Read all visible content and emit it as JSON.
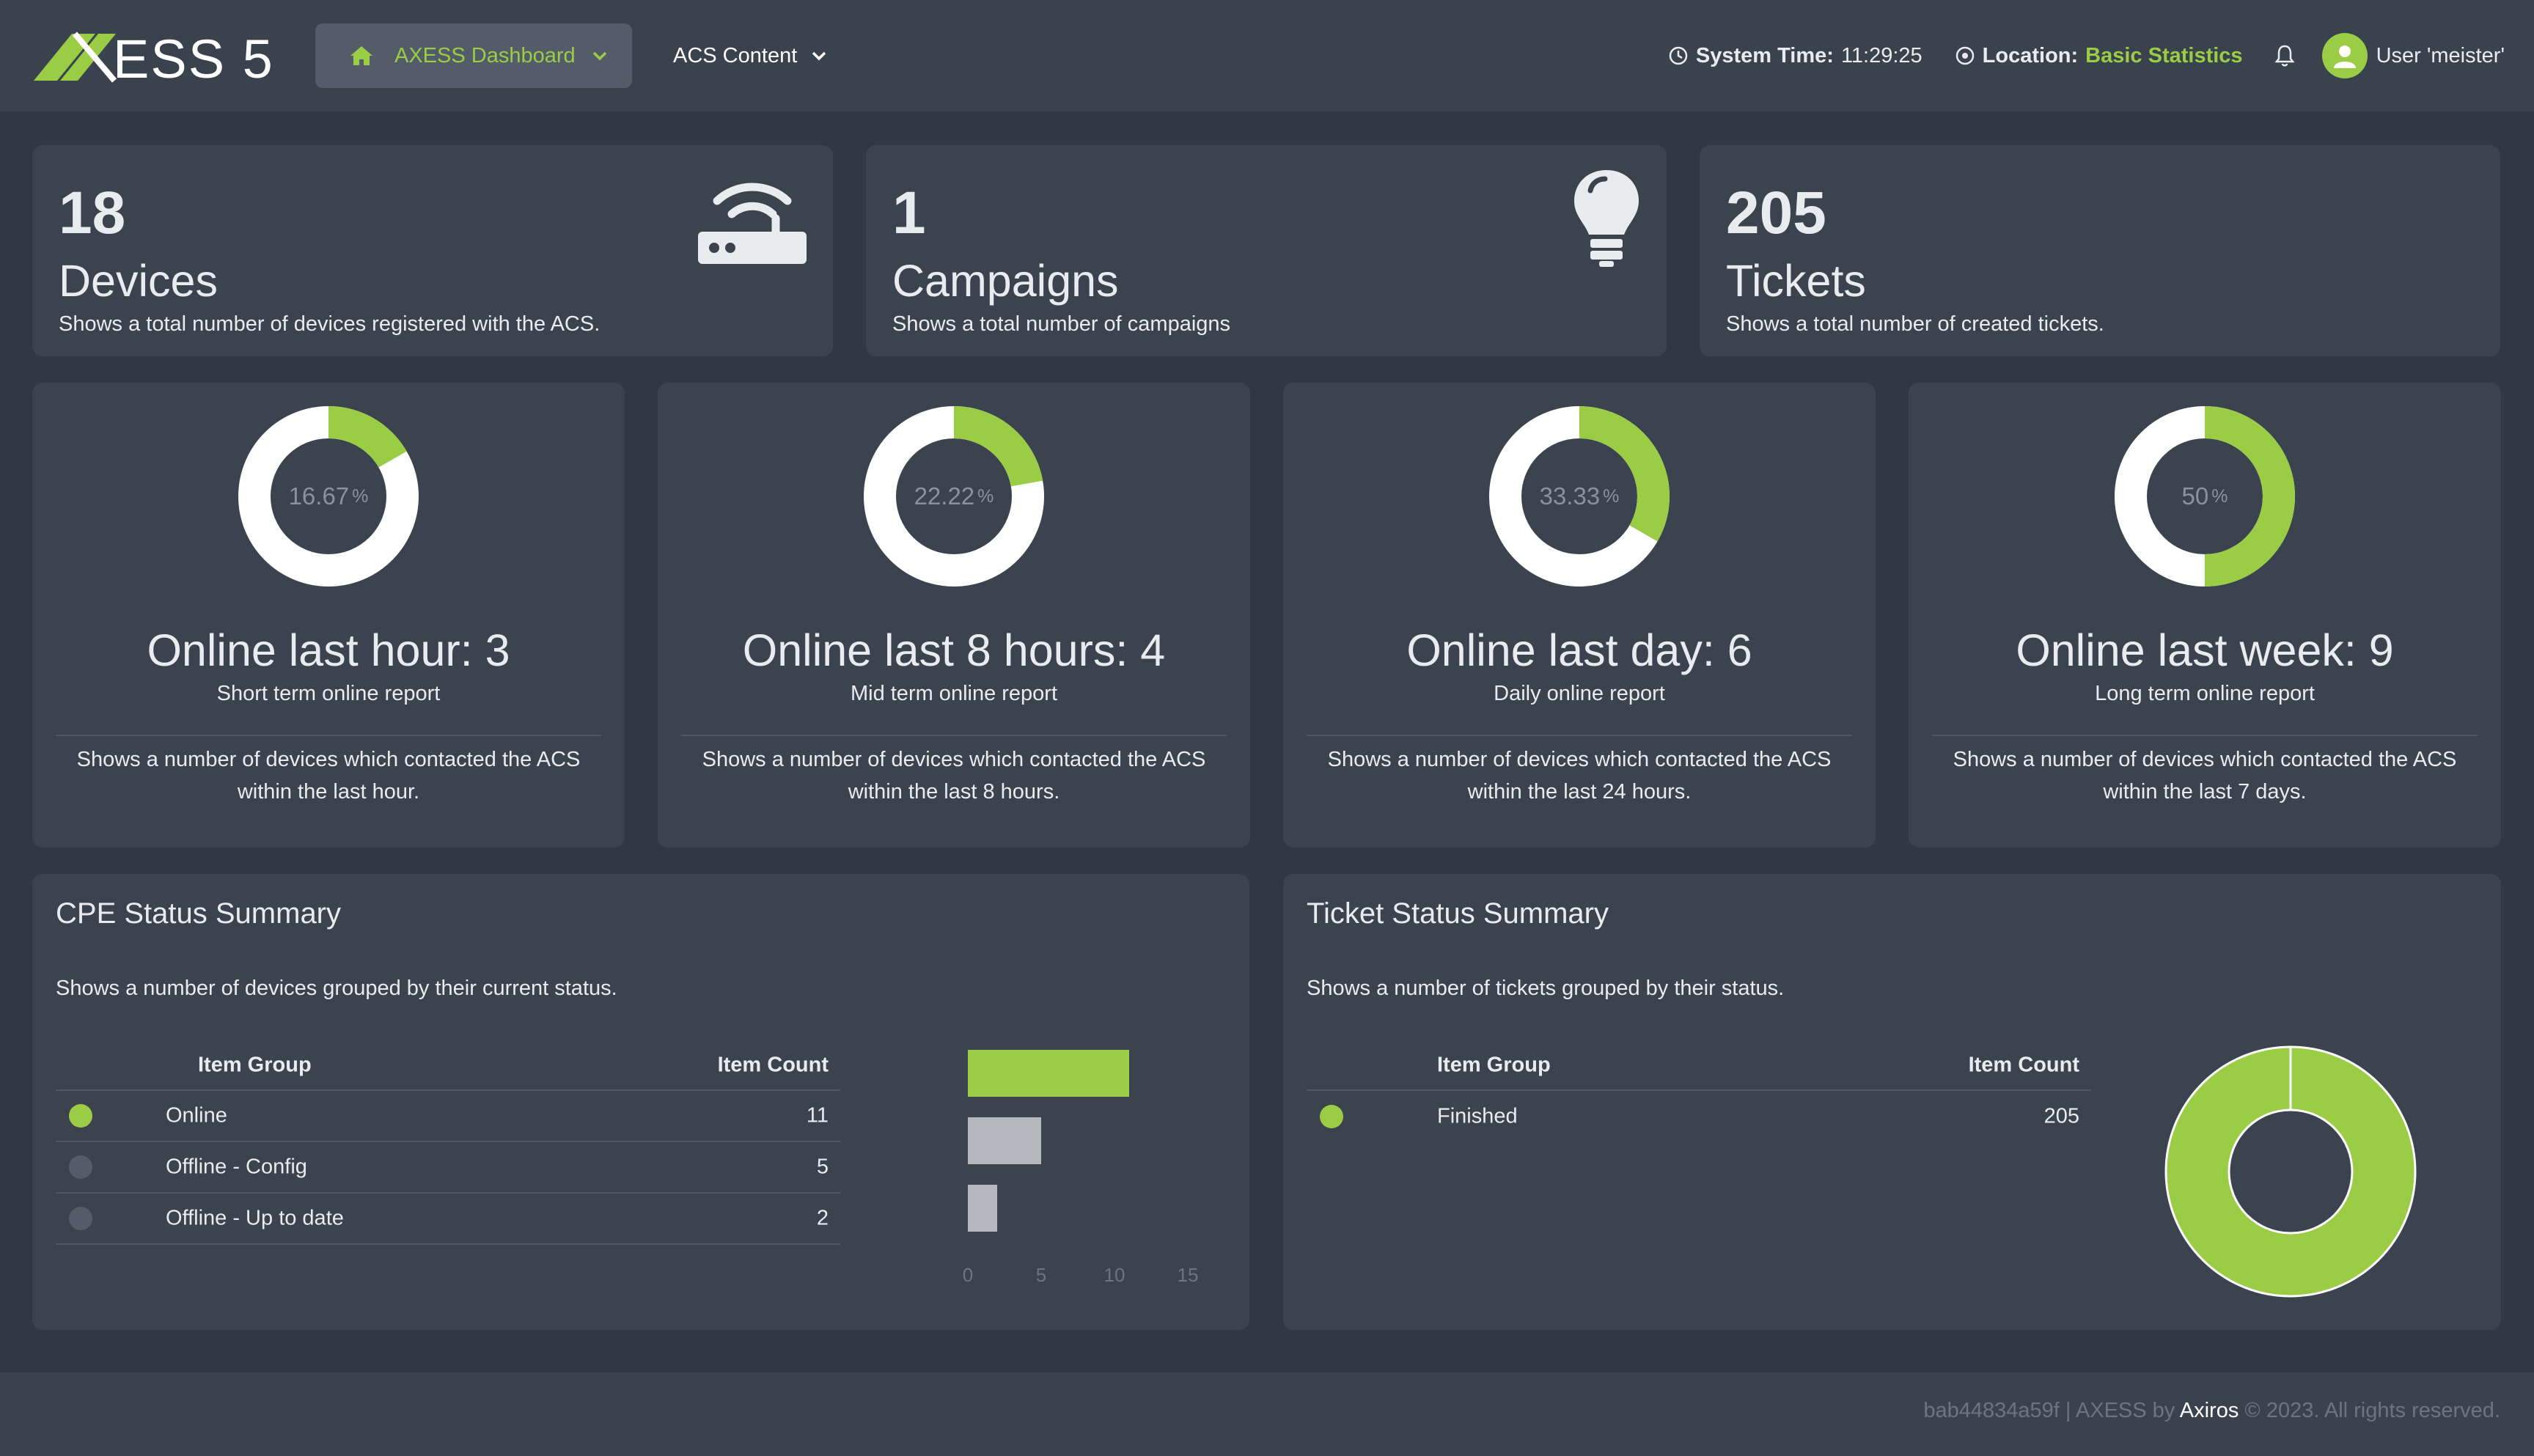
{
  "colors": {
    "accent": "#9acd45",
    "card": "#3a434e",
    "background": "#2f3843",
    "muted": "#535c68",
    "bar_gray": "#b4b8bd"
  },
  "header": {
    "logo_text": "AXESS 5",
    "nav_dashboard_label": "AXESS Dashboard",
    "nav_dashboard_icon": "home-icon",
    "nav_acs_label": "ACS Content",
    "system_time_label": "System Time:",
    "system_time_value": "11:29:25",
    "location_label": "Location:",
    "location_value": "Basic Statistics",
    "user_label": "User 'meister'"
  },
  "stats": [
    {
      "number": "18",
      "title": "Devices",
      "desc": "Shows a total number of devices registered with the ACS.",
      "icon": "router-icon"
    },
    {
      "number": "1",
      "title": "Campaigns",
      "desc": "Shows a total number of campaigns",
      "icon": "lightbulb-icon"
    },
    {
      "number": "205",
      "title": "Tickets",
      "desc": "Shows a total number of created tickets."
    }
  ],
  "online": [
    {
      "percent": "16.67",
      "percent_value": 16.67,
      "pct_sign": "%",
      "title": "Online last hour: 3",
      "subtitle": "Short term online report",
      "desc": "Shows a number of devices which contacted the ACS within the last hour."
    },
    {
      "percent": "22.22",
      "percent_value": 22.22,
      "pct_sign": "%",
      "title": "Online last 8 hours: 4",
      "subtitle": "Mid term online report",
      "desc": "Shows a number of devices which contacted the ACS within the last 8 hours."
    },
    {
      "percent": "33.33",
      "percent_value": 33.33,
      "pct_sign": "%",
      "title": "Online last day: 6",
      "subtitle": "Daily online report",
      "desc": "Shows a number of devices which contacted the ACS within the last 24 hours."
    },
    {
      "percent": "50",
      "percent_value": 50,
      "pct_sign": "%",
      "title": "Online last week: 9",
      "subtitle": "Long term online report",
      "desc": "Shows a number of devices which contacted the ACS within the last 7 days."
    }
  ],
  "cpe": {
    "title": "CPE Status Summary",
    "desc": "Shows a number of devices grouped by their current status.",
    "col_group": "Item Group",
    "col_count": "Item Count",
    "rows": [
      {
        "group": "Online",
        "count": "11",
        "status": "on"
      },
      {
        "group": "Offline - Config",
        "count": "5",
        "status": "off"
      },
      {
        "group": "Offline - Up to date",
        "count": "2",
        "status": "off"
      }
    ]
  },
  "tickets": {
    "title": "Ticket Status Summary",
    "desc": "Shows a number of tickets grouped by their status.",
    "col_group": "Item Group",
    "col_count": "Item Count",
    "rows": [
      {
        "group": "Finished",
        "count": "205",
        "status": "on"
      }
    ]
  },
  "chart_data": [
    {
      "type": "bar",
      "orientation": "horizontal",
      "categories": [
        "Online",
        "Offline - Config",
        "Offline - Up to date"
      ],
      "values": [
        11,
        5,
        2
      ],
      "xlim": [
        0,
        15
      ],
      "ticks": [
        "0",
        "5",
        "10",
        "15"
      ],
      "colors": [
        "#9acd45",
        "#b4b8bd",
        "#b4b8bd"
      ]
    },
    {
      "type": "pie",
      "categories": [
        "Finished"
      ],
      "values": [
        205
      ],
      "colors": [
        "#9acd45"
      ]
    }
  ],
  "footer": {
    "hash": "bab44834a59f | AXESS by ",
    "brand": "Axiros",
    "copyright": " © 2023. All rights reserved."
  }
}
